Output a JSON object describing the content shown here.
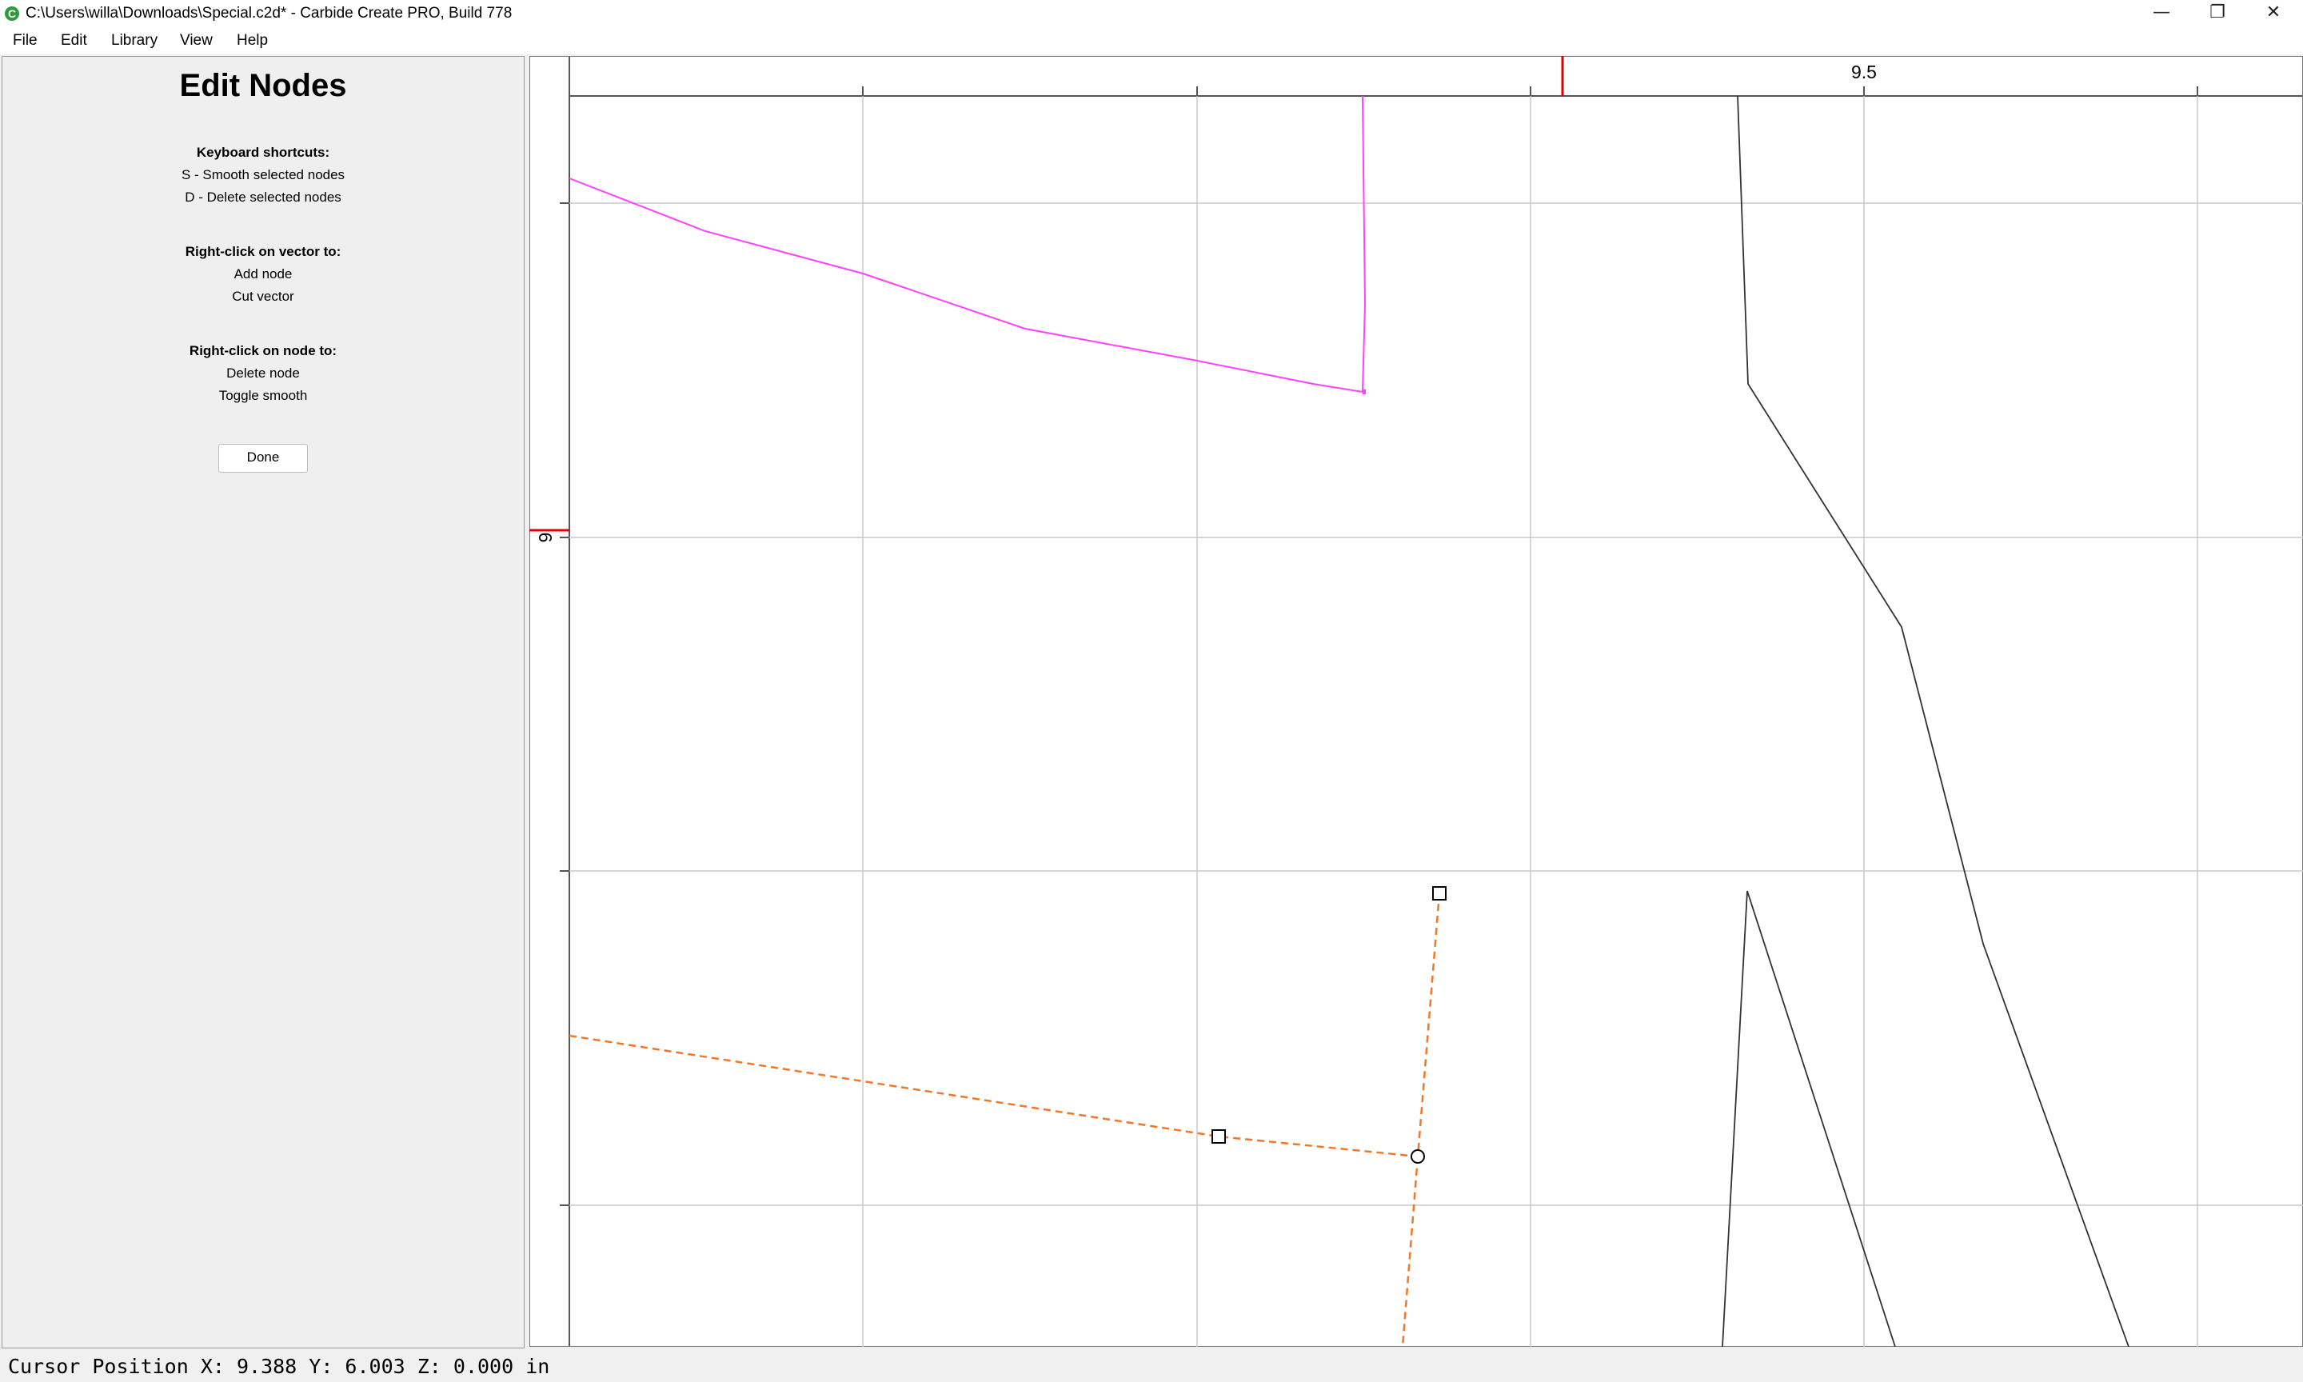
{
  "window": {
    "title": "C:\\Users\\willa\\Downloads\\Special.c2d* - Carbide Create PRO, Build 778",
    "app_icon": "C",
    "minimize_glyph": "—",
    "maximize_glyph": "❐",
    "close_glyph": "✕"
  },
  "menu": {
    "file": "File",
    "edit": "Edit",
    "library": "Library",
    "view": "View",
    "help": "Help"
  },
  "panel": {
    "title": "Edit Nodes",
    "shortcuts_heading": "Keyboard shortcuts:",
    "shortcut_smooth": "S - Smooth selected nodes",
    "shortcut_delete": "D - Delete selected nodes",
    "vector_heading": "Right-click on vector to:",
    "vector_add_node": "Add node",
    "vector_cut": "Cut vector",
    "node_heading": "Right-click on node to:",
    "node_delete": "Delete node",
    "node_toggle_smooth": "Toggle smooth",
    "done_label": "Done"
  },
  "canvas": {
    "ruler_x_label": "9.5",
    "ruler_y_label": "6",
    "colors": {
      "grid": "#c8c8c8",
      "ruler_marker": "#e00000",
      "magenta_vector": "#ff40ff",
      "selected_vector": "#f07828",
      "other_vector": "#333333"
    }
  },
  "status": {
    "cursor_position": "Cursor Position X: 9.388 Y: 6.003 Z: 0.000 in"
  }
}
